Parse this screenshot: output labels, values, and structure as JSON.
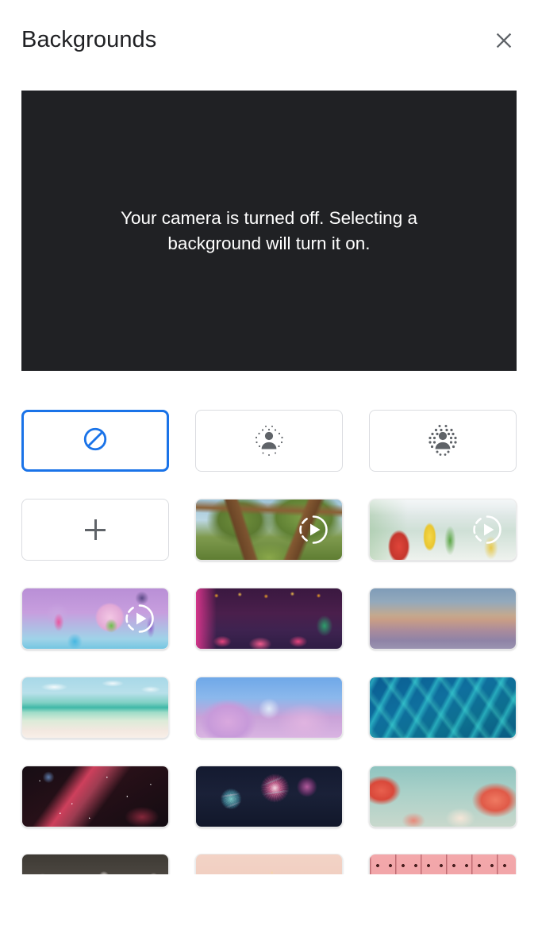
{
  "header": {
    "title": "Backgrounds",
    "close_icon": "close-icon"
  },
  "preview": {
    "message": "Your camera is turned off. Selecting a background will turn it on."
  },
  "grid": {
    "rows": [
      [
        {
          "name": "no-effect",
          "kind": "icon",
          "icon": "block-slash-circle-icon",
          "selected": true,
          "art": ""
        },
        {
          "name": "slight-blur",
          "kind": "icon",
          "icon": "person-slight-blur-icon",
          "selected": false,
          "art": ""
        },
        {
          "name": "blur",
          "kind": "icon",
          "icon": "person-blur-icon",
          "selected": false,
          "art": ""
        }
      ],
      [
        {
          "name": "add-background",
          "kind": "icon",
          "icon": "plus-icon",
          "selected": false,
          "art": ""
        },
        {
          "name": "forest-video",
          "kind": "video",
          "icon": "play-loop-icon",
          "selected": false,
          "art": "art-forest"
        },
        {
          "name": "classroom-video",
          "kind": "video",
          "icon": "play-loop-icon",
          "selected": false,
          "art": "art-classroom"
        }
      ],
      [
        {
          "name": "monsters-video",
          "kind": "video",
          "icon": "play-loop-icon",
          "selected": false,
          "art": "art-monsters"
        },
        {
          "name": "night-cafe",
          "kind": "image",
          "icon": "",
          "selected": false,
          "art": "art-cafe"
        },
        {
          "name": "dusk-sky",
          "kind": "image",
          "icon": "",
          "selected": false,
          "art": "art-dusk"
        }
      ],
      [
        {
          "name": "beach",
          "kind": "image",
          "icon": "",
          "selected": false,
          "art": "art-beach"
        },
        {
          "name": "pink-clouds",
          "kind": "image",
          "icon": "",
          "selected": false,
          "art": "art-clouds"
        },
        {
          "name": "water-caustics",
          "kind": "image",
          "icon": "",
          "selected": false,
          "art": "art-water"
        }
      ],
      [
        {
          "name": "space-nebula",
          "kind": "image",
          "icon": "",
          "selected": false,
          "art": "art-nebula"
        },
        {
          "name": "fireworks",
          "kind": "image",
          "icon": "",
          "selected": false,
          "art": "art-fireworks"
        },
        {
          "name": "blossom-branches",
          "kind": "image",
          "icon": "",
          "selected": false,
          "art": "art-blossom"
        }
      ],
      [
        {
          "name": "roses",
          "kind": "image",
          "icon": "",
          "selected": false,
          "art": "art-roses"
        },
        {
          "name": "peach-gradient",
          "kind": "image",
          "icon": "",
          "selected": false,
          "art": "art-peach"
        },
        {
          "name": "pink-pattern",
          "kind": "image",
          "icon": "",
          "selected": false,
          "art": "art-pinkpattern"
        }
      ]
    ]
  },
  "colors": {
    "selected_border": "#1a73e8",
    "tile_border": "#dadce0",
    "preview_background": "#202124",
    "icon_gray": "#5f6368",
    "title_text": "#202124",
    "preview_text": "#ffffff"
  }
}
